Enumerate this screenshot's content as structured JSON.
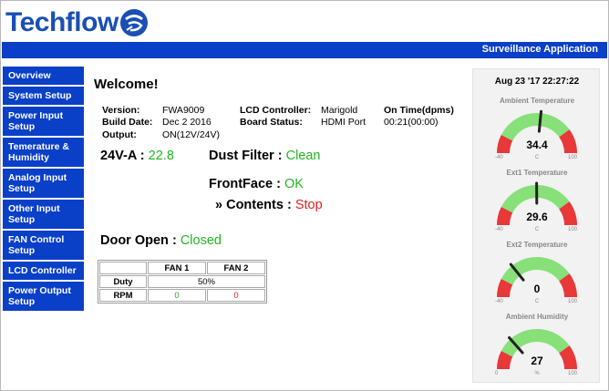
{
  "app": {
    "logo": "Techflow",
    "title": "Surveillance Application"
  },
  "sidebar": {
    "items": [
      {
        "label": "Overview",
        "lines": 1
      },
      {
        "label": "System Setup",
        "lines": 1
      },
      {
        "label": "Power Input Setup",
        "lines": 2
      },
      {
        "label": "Temerature & Humidity",
        "lines": 2
      },
      {
        "label": "Analog Input Setup",
        "lines": 2
      },
      {
        "label": "Other Input Setup",
        "lines": 2
      },
      {
        "label": "FAN Control Setup",
        "lines": 2
      },
      {
        "label": "LCD Controller",
        "lines": 1
      },
      {
        "label": "Power Output Setup",
        "lines": 2
      }
    ]
  },
  "main": {
    "welcome": "Welcome!",
    "info": {
      "version_label": "Version:",
      "version": "FWA9009",
      "build_label": "Build Date:",
      "build": "Dec 2 2016",
      "output_label": "Output:",
      "output": "ON(12V/24V)",
      "lcd_label": "LCD Controller:",
      "lcd": "Marigold",
      "board_label": "Board Status:",
      "board": "HDMI Port",
      "ontime_label": "On Time(dpms)",
      "ontime": "00:21(00:00)"
    },
    "v24_label": "24V-A :",
    "v24_value": "22.8",
    "dust_label": "Dust Filter :",
    "dust_value": "Clean",
    "frontface_label": "FrontFace :",
    "frontface_value": "OK",
    "contents_label": "» Contents :",
    "contents_value": "Stop",
    "door_label": "Door Open :",
    "door_value": "Closed",
    "fan_table": {
      "headers": [
        "",
        "FAN 1",
        "FAN 2"
      ],
      "duty_label": "Duty",
      "duty": "50%",
      "rpm_label": "RPM",
      "rpm1": "0",
      "rpm2": "0"
    }
  },
  "gauges": {
    "datetime": "Aug 23 '17 22:27:22",
    "items": [
      {
        "title": "Ambient Temperature",
        "value": "34.4",
        "num": 34.4,
        "min": "-40",
        "max": "100",
        "unit": "C"
      },
      {
        "title": "Ext1 Temperature",
        "value": "29.6",
        "num": 29.6,
        "min": "-40",
        "max": "100",
        "unit": "C"
      },
      {
        "title": "Ext2 Temperature",
        "value": "0",
        "num": 0,
        "min": "-40",
        "max": "100",
        "unit": "C"
      },
      {
        "title": "Ambient Humidity",
        "value": "27",
        "num": 27,
        "min": "0",
        "max": "100",
        "unit": "%"
      }
    ],
    "colors": {
      "low": "#e83838",
      "mid": "#88e078",
      "high": "#e83838",
      "needle": "#222222"
    }
  }
}
